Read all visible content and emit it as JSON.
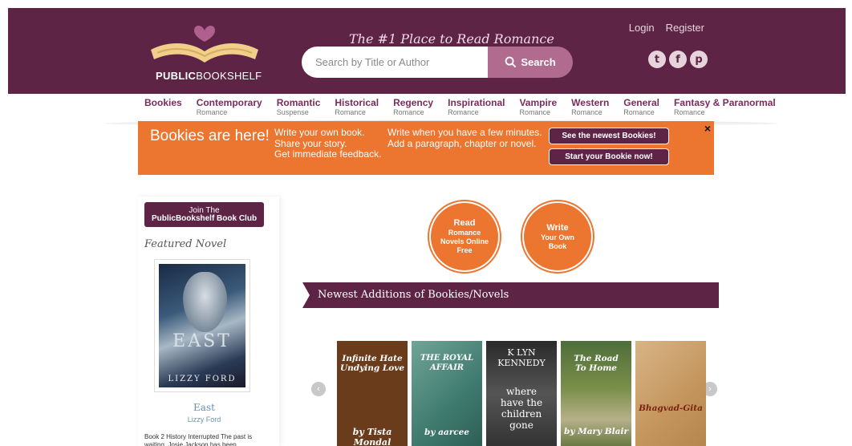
{
  "header": {
    "logo_bold": "PUBLIC",
    "logo_rest": "BOOKSHELF",
    "tagline": "The #1 Place to Read Romance",
    "login": "Login",
    "register": "Register",
    "search_placeholder": "Search by Title or Author",
    "search_button": "Search",
    "social": [
      "twitter-icon",
      "facebook-icon",
      "pinterest-icon"
    ]
  },
  "nav": [
    {
      "main": "Bookies",
      "sub": ""
    },
    {
      "main": "Contemporary",
      "sub": "Romance"
    },
    {
      "main": "Romantic",
      "sub": "Suspense"
    },
    {
      "main": "Historical",
      "sub": "Romance"
    },
    {
      "main": "Regency",
      "sub": "Romance"
    },
    {
      "main": "Inspirational",
      "sub": "Romance"
    },
    {
      "main": "Vampire",
      "sub": "Romance"
    },
    {
      "main": "Western",
      "sub": "Romance"
    },
    {
      "main": "General",
      "sub": "Romance"
    },
    {
      "main": "Fantasy & Paranormal",
      "sub": "Romance"
    }
  ],
  "banner": {
    "title": "Bookies are here!",
    "col1": [
      "Write your own book.",
      "Share your story.",
      "Get immediate feedback."
    ],
    "col2": [
      "Write when you have a few minutes.",
      "Add a paragraph, chapter or novel."
    ],
    "btn_newest": "See the newest Bookies!",
    "btn_start": "Start your Bookie now!",
    "close": "×"
  },
  "sidebar": {
    "join_line1": "Join The",
    "join_line2": "PublicBookshelf Book Club",
    "featured_label": "Featured Novel",
    "cover_title": "EAST",
    "cover_author": "LIZZY FORD",
    "title": "East",
    "author": "Lizzy Ford",
    "description": "Book 2 History Interrupted The past is waiting. Josie Jackson has been"
  },
  "circles": {
    "read": {
      "big": "Read",
      "small": "Romance Novels Online Free"
    },
    "write": {
      "big": "Write",
      "small": "Your Own Book"
    }
  },
  "newest": {
    "heading": "Newest Additions of Bookies/Novels",
    "prev": "‹",
    "next": "›",
    "books": [
      {
        "title": "Infinite Hate Undying Love",
        "author": "by Tista Mondal"
      },
      {
        "title": "THE ROYAL AFFAIR",
        "author": "by aarcee"
      },
      {
        "title": "K LYN KENNEDY",
        "subtitle": "where have the children gone"
      },
      {
        "title": "The Road To Home",
        "author": "by Mary Blair"
      },
      {
        "title": "Bhagvad-Gita"
      }
    ]
  },
  "colors": {
    "brand": "#5e2446",
    "accent": "#ec7530",
    "search_button": "#b06b8f"
  }
}
